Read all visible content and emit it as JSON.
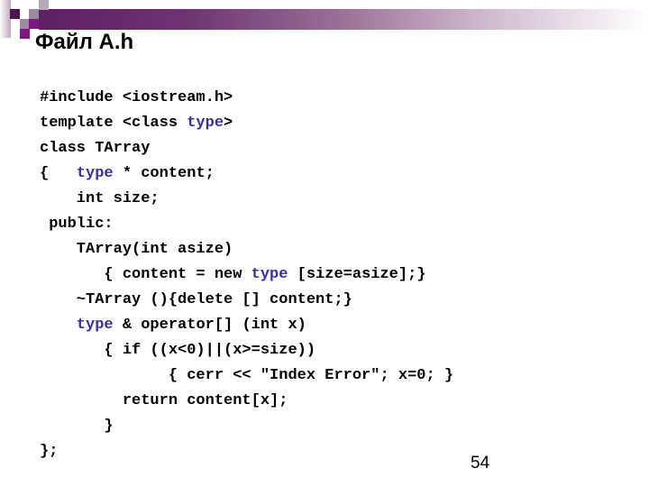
{
  "slide": {
    "title": "Файл A.h",
    "page_number": "54",
    "keyword_color": "#3a2e9a",
    "accent_color": "#5e1f63"
  },
  "code": {
    "language": "cpp",
    "lines": [
      [
        {
          "t": "#include <iostream.h>"
        }
      ],
      [
        {
          "t": "template <class "
        },
        {
          "t": "type",
          "kw": true
        },
        {
          "t": ">"
        }
      ],
      [
        {
          "t": "class TArray"
        }
      ],
      [
        {
          "t": "{   "
        },
        {
          "t": "type",
          "kw": true
        },
        {
          "t": " * content;"
        }
      ],
      [
        {
          "t": "    int size;"
        }
      ],
      [
        {
          "t": " public:"
        }
      ],
      [
        {
          "t": "    TArray(int asize)"
        }
      ],
      [
        {
          "t": "       { content = new "
        },
        {
          "t": "type",
          "kw": true
        },
        {
          "t": " [size=asize];}"
        }
      ],
      [
        {
          "t": "    ~TArray (){delete [] content;}"
        }
      ],
      [
        {
          "t": "    "
        },
        {
          "t": "type",
          "kw": true
        },
        {
          "t": " & operator[] (int x)"
        }
      ],
      [
        {
          "t": "       { if ((x<0)||(x>=size))"
        }
      ],
      [
        {
          "t": "              { cerr << \"Index Error\"; x=0; }"
        }
      ],
      [
        {
          "t": "         return content[x];"
        }
      ],
      [
        {
          "t": "       }"
        }
      ],
      [
        {
          "t": "};"
        }
      ]
    ]
  }
}
